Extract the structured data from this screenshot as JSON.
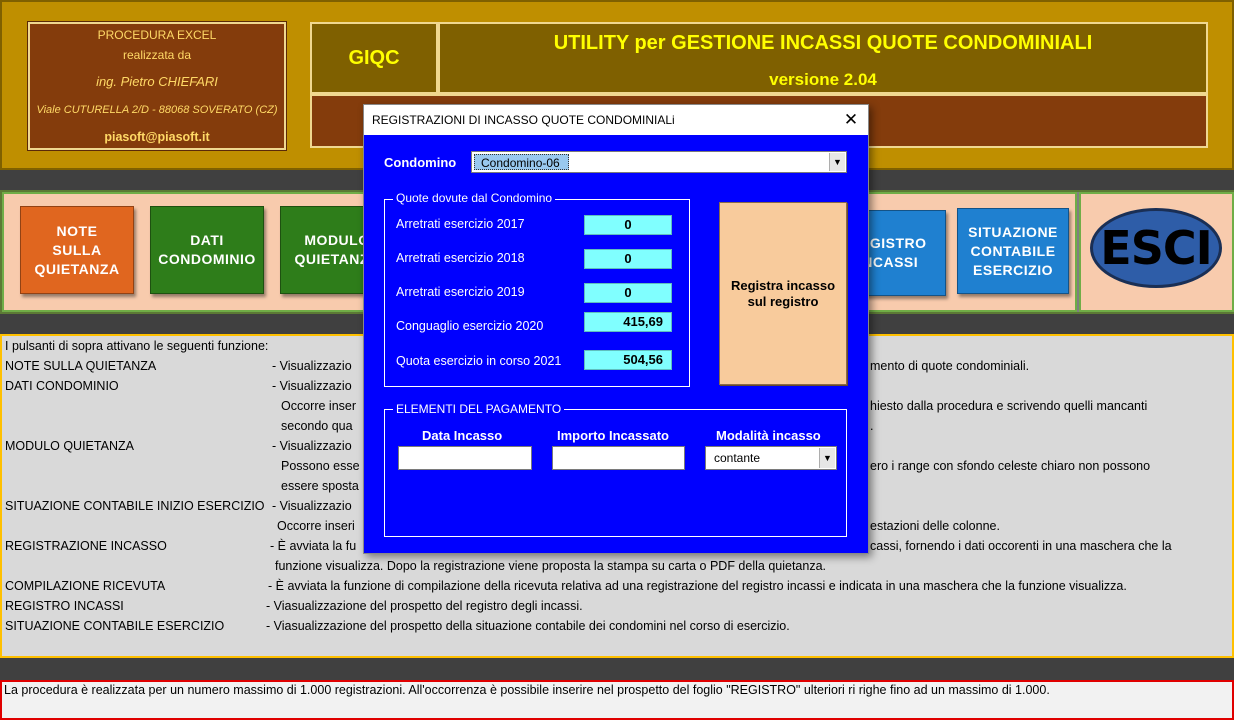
{
  "header": {
    "info_line1": "PROCEDURA EXCEL",
    "info_line2": "realizzata da",
    "info_author": "ing. Pietro CHIEFARI",
    "info_address": "Viale CUTURELLA 2/D - 88068 SOVERATO (CZ)",
    "info_email": "piasoft@piasoft.it",
    "acronym": "GIQC",
    "title": "UTILITY per GESTIONE INCASSI QUOTE CONDOMINIALI",
    "version": "versione 2.04"
  },
  "buttons": [
    {
      "label": "NOTE\nSULLA\nQUIETANZA",
      "color": "#e0661f"
    },
    {
      "label": "DATI\nCONDOMINIO",
      "color": "#2e7d1a"
    },
    {
      "label": "MODULO\nQUIETANZA",
      "color": "#2e7d1a"
    },
    {
      "label": "REGISTRO\nINCASSI",
      "color": "#1f80d0"
    },
    {
      "label": "SITUAZIONE\nCONTABILE\nESERCIZIO",
      "color": "#1f80d0"
    },
    {
      "label": "ESCI",
      "color": "#2e5da8"
    }
  ],
  "description": {
    "intro": "I pulsanti di sopra attivano le seguenti funzione:",
    "rows": [
      {
        "name": "NOTE SULLA QUIETANZA",
        "text": "- Visualizzazio",
        "tail": "mento di quote condominiali."
      },
      {
        "name": "DATI CONDOMINIO",
        "text": "- Visualizzazio"
      },
      {
        "name": "",
        "text": "Occorre inser",
        "tail": "hiesto dalla procedura e scrivendo quelli mancanti"
      },
      {
        "name": "",
        "text": "secondo  qua",
        "tail": "."
      },
      {
        "name": "MODULO QUIETANZA",
        "text": "- Visualizzazio"
      },
      {
        "name": "",
        "text": "Possono esse",
        "tail": "ero i range con sfondo celeste chiaro non possono"
      },
      {
        "name": "",
        "text": "essere sposta"
      },
      {
        "name": "SITUAZIONE CONTABILE INIZIO ESERCIZIO",
        "text": "- Visualizzazio"
      },
      {
        "name": "",
        "text": "Occorre inseri",
        "tail": "estazioni delle colonne."
      },
      {
        "name": "REGISTRAZIONE INCASSO",
        "text": "- È avviata la fu",
        "tail": "cassi, fornendo i dati occorenti in una maschera che la"
      },
      {
        "name": "",
        "text": "funzione visualizza. Dopo la registrazione viene proposta la stampa su carta o PDF della quietanza."
      },
      {
        "name": "COMPILAZIONE RICEVUTA",
        "text": "- È avviata la funzione di compilazione della ricevuta relativa ad una registrazione del registro incassi e indicata in una maschera che la funzione visualizza."
      },
      {
        "name": "REGISTRO INCASSI",
        "text": "- Viasualizzazione del prospetto del registro degli incassi."
      },
      {
        "name": "SITUAZIONE CONTABILE ESERCIZIO",
        "text": "- Viasualizzazione del prospetto della situazione contabile dei condomini nel corso di esercizio."
      }
    ]
  },
  "footer": {
    "text": "La procedura è realizzata per un numero massimo di 1.000 registrazioni. All'occorrenza è possibile inserire nel prospetto del foglio \"REGISTRO\" ulteriori ri righe fino ad un massimo di 1.000."
  },
  "dialog": {
    "title": "REGISTRAZIONI DI INCASSO QUOTE CONDOMINIALi",
    "close_glyph": "✕",
    "condominio_label": "Condomino",
    "condominio_value": "Condomino-06",
    "quote_caption": "Quote dovute dal Condomino",
    "quote": [
      {
        "label": "Arretrati esercizio 2017",
        "value": "0"
      },
      {
        "label": "Arretrati esercizio 2018",
        "value": "0"
      },
      {
        "label": "Arretrati esercizio 2019",
        "value": "0"
      },
      {
        "label": "Conguaglio esercizio 2020",
        "value": "415,69"
      },
      {
        "label": "Quota esercizio in corso 2021",
        "value": "504,56"
      }
    ],
    "register_button": "Registra incasso\nsul registro",
    "pagamento_caption": "ELEMENTI DEL PAGAMENTO",
    "data_incasso_label": "Data Incasso",
    "data_incasso_value": "",
    "importo_label": "Importo Incassato",
    "importo_value": "",
    "modalita_label": "Modalità incasso",
    "modalita_value": "contante"
  }
}
